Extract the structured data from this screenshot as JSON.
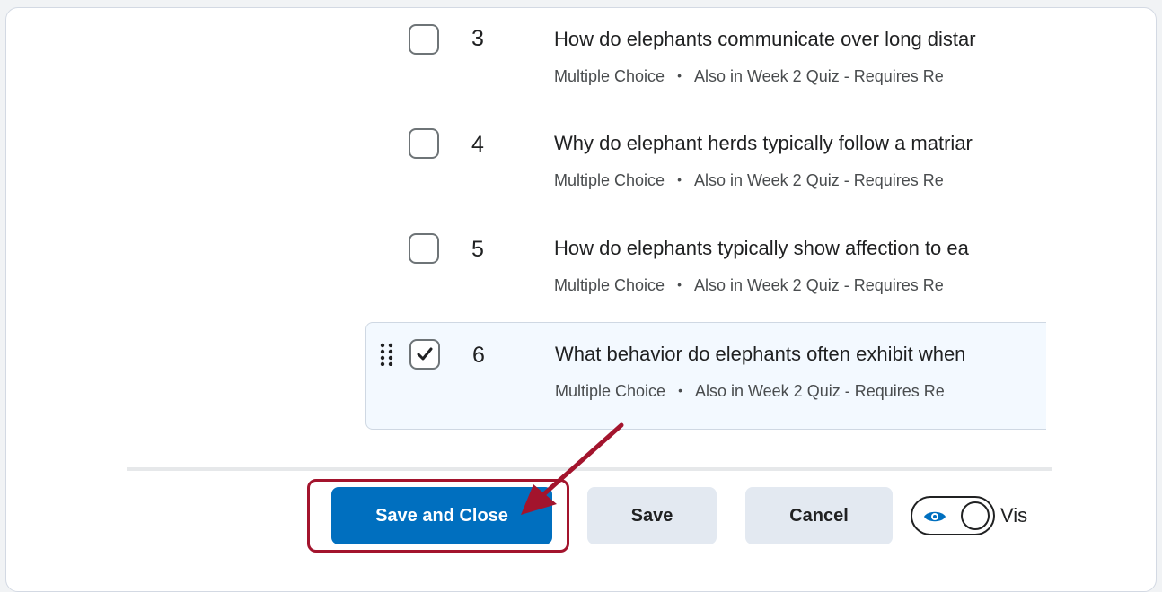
{
  "questions": [
    {
      "number": "3",
      "title": "How do elephants communicate over long distar",
      "type": "Multiple Choice",
      "separator": "•",
      "context": "Also in Week 2 Quiz - Requires Re",
      "checked": false
    },
    {
      "number": "4",
      "title": "Why do elephant herds typically follow a matriar",
      "type": "Multiple Choice",
      "separator": "•",
      "context": "Also in Week 2 Quiz - Requires Re",
      "checked": false
    },
    {
      "number": "5",
      "title": "How do elephants typically show affection to ea",
      "type": "Multiple Choice",
      "separator": "•",
      "context": "Also in Week 2 Quiz - Requires Re",
      "checked": false
    },
    {
      "number": "6",
      "title": "What behavior do elephants often exhibit when",
      "type": "Multiple Choice",
      "separator": "•",
      "context": "Also in Week 2 Quiz - Requires Re",
      "checked": true
    }
  ],
  "footer": {
    "save_close_label": "Save and Close",
    "save_label": "Save",
    "cancel_label": "Cancel",
    "visibility_label": "Vis"
  },
  "icons": {
    "drag": "drag-handle-icon",
    "check": "checkmark-icon",
    "eye": "eye-icon",
    "annotation": "annotation-arrow-icon"
  },
  "colors": {
    "primary": "#006fbf",
    "secondary_button": "#e3e9f1",
    "selected_row": "#f3f9ff",
    "annotation": "#a3142d"
  }
}
